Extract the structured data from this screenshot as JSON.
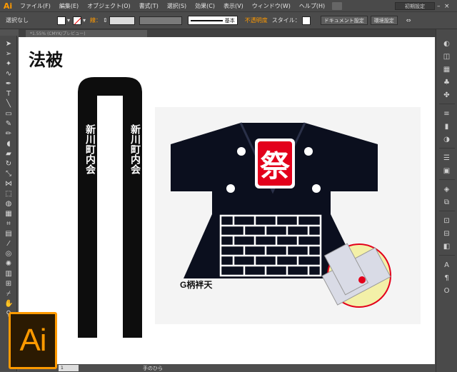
{
  "app": {
    "logo": "Ai",
    "workspace": "初期設定"
  },
  "menu": [
    "ファイル(F)",
    "編集(E)",
    "オブジェクト(O)",
    "書式(T)",
    "選択(S)",
    "効果(C)",
    "表示(V)",
    "ウィンドウ(W)",
    "ヘルプ(H)"
  ],
  "control": {
    "selection": "選択なし",
    "stroke_label": "線：",
    "brush_label": "基本",
    "opacity_label": "不透明度",
    "style_label": "スタイル：",
    "doc_setup": "ドキュメント設定",
    "prefs": "環境設定"
  },
  "tab": {
    "title": "*1.55% (CMYK/プレビュー)"
  },
  "document": {
    "title": "法被",
    "tenugui_left": "新川町内会",
    "tenugui_right": "新川町内会",
    "happi_kanji": "祭",
    "caption": "G柄袢天"
  },
  "status": {
    "zoom": "1",
    "tool_name": "手のひら"
  },
  "colors": {
    "accent": "#ff9a00",
    "panel": "#4a4a4a",
    "canvas": "#ffffff",
    "happi_red": "#e3001b",
    "happi_navy": "#0b0f1e"
  }
}
